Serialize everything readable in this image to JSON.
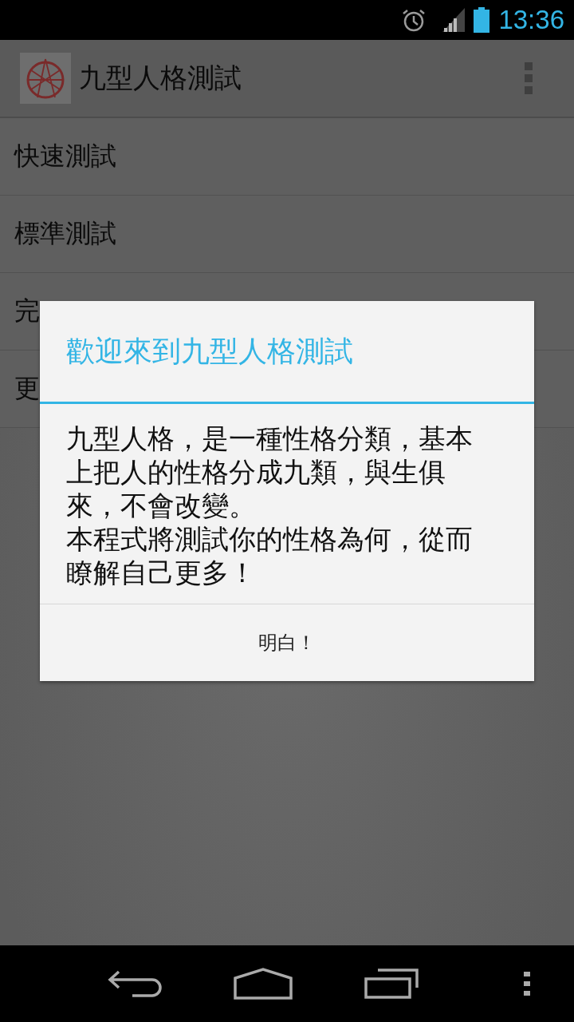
{
  "status_bar": {
    "time": "13:36"
  },
  "action_bar": {
    "title": "九型人格測試"
  },
  "menu_items": [
    "快速測試",
    "標準測試",
    "完",
    "更"
  ],
  "dialog": {
    "title": "歡迎來到九型人格測試",
    "message": [
      "九型人格，是一種性格分類，基本上把人的性格分成九類，與生俱來，不會改變。",
      "本程式將測試你的性格為何，從而瞭解自己更多！"
    ],
    "button": "明白！"
  }
}
